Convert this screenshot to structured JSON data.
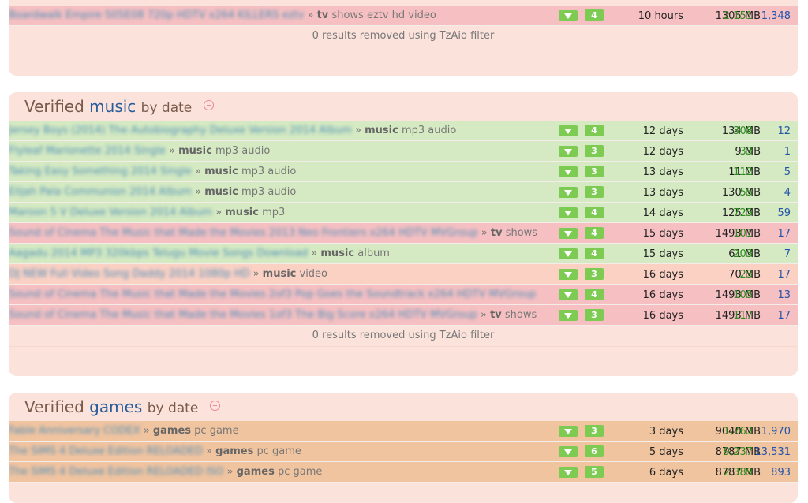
{
  "tv": {
    "rows": [
      {
        "title": "Boardwalk Empire S05E08 720p HDTV x264 KILLERS eztv",
        "cat": "tv",
        "sub": "shows eztv hd video",
        "score": "4",
        "age": "10 hours",
        "size": "1305 MB",
        "seeds": "2,151",
        "leeches": "1,348",
        "color": "pink"
      }
    ],
    "filter_text": "0 results removed using TzAio filter"
  },
  "music": {
    "heading": {
      "prefix": "Verified",
      "category": "music",
      "suffix": "by date"
    },
    "rows": [
      {
        "title": "Jersey Boys (2014) The Autobiography Deluxe Version 2014 Album",
        "cat": "music",
        "sub": "mp3 audio",
        "score": "4",
        "age": "12 days",
        "size": "134 MB",
        "seeds": "308",
        "leeches": "12",
        "color": "green"
      },
      {
        "title": "Flyleaf Marionette 2014 Single",
        "cat": "music",
        "sub": "mp3 audio",
        "score": "3",
        "age": "12 days",
        "size": "9 MB",
        "seeds": "33",
        "leeches": "1",
        "color": "green"
      },
      {
        "title": "Taking Easy Something 2014 Single",
        "cat": "music",
        "sub": "mp3 audio",
        "score": "3",
        "age": "13 days",
        "size": "11 MB",
        "seeds": "112",
        "leeches": "5",
        "color": "green"
      },
      {
        "title": "Elijah Pala Communion 2014 Album",
        "cat": "music",
        "sub": "mp3 audio",
        "score": "3",
        "age": "13 days",
        "size": "130 MB",
        "seeds": "55",
        "leeches": "4",
        "color": "green"
      },
      {
        "title": "Maroon 5 V Deluxe Version 2014 Album",
        "cat": "music",
        "sub": "mp3",
        "score": "4",
        "age": "14 days",
        "size": "125 MB",
        "seeds": "725",
        "leeches": "59",
        "color": "green"
      },
      {
        "title": "Sound of Cinema The Music that Made the Movies 2013 Neo Frontiers x264 HDTV MVGroup",
        "cat": "tv",
        "sub": "shows",
        "score": "4",
        "age": "15 days",
        "size": "1493 MB",
        "seeds": "101",
        "leeches": "17",
        "color": "pink"
      },
      {
        "title": "Aagadu 2014 MP3 320kbps Telugu Movie Songs Download",
        "cat": "music",
        "sub": "album",
        "score": "4",
        "age": "15 days",
        "size": "61 MB",
        "seeds": "203",
        "leeches": "7",
        "color": "green"
      },
      {
        "title": "DJ NEW Full Video Song Daddy 2014 1080p HD",
        "cat": "music",
        "sub": "video",
        "score": "3",
        "age": "16 days",
        "size": "70 MB",
        "seeds": "23",
        "leeches": "17",
        "color": "salmon"
      },
      {
        "title": "Sound of Cinema The Music that Made the Movies 2of3 Pop Goes the Soundtrack x264 HDTV MVGroup",
        "cat": "",
        "sub": "",
        "score": "4",
        "age": "16 days",
        "size": "1493 MB",
        "seeds": "105",
        "leeches": "13",
        "color": "pink"
      },
      {
        "title": "Sound of Cinema The Music that Made the Movies 1of3 The Big Score x264 HDTV MVGroup",
        "cat": "tv",
        "sub": "shows",
        "score": "3",
        "age": "16 days",
        "size": "1493 MB",
        "seeds": "117",
        "leeches": "17",
        "color": "pink"
      }
    ],
    "filter_text": "0 results removed using TzAio filter"
  },
  "games": {
    "heading": {
      "prefix": "Verified",
      "category": "games",
      "suffix": "by date"
    },
    "rows": [
      {
        "title": "Fable Anniversary CODEX",
        "cat": "games",
        "sub": "pc game",
        "score": "3",
        "age": "3 days",
        "size": "9040 MB",
        "seeds": "1,763",
        "leeches": "1,970",
        "color": "orange"
      },
      {
        "title": "The SIMS 4 Deluxe Edition RELOADED",
        "cat": "games",
        "sub": "pc game",
        "score": "6",
        "age": "5 days",
        "size": "8787 MB",
        "seeds": "9,237",
        "leeches": "13,531",
        "color": "orange"
      },
      {
        "title": "The SIMS 4 Deluxe Edition RELOADED ISO",
        "cat": "games",
        "sub": "pc game",
        "score": "5",
        "age": "6 days",
        "size": "8787 MB",
        "seeds": "2,389",
        "leeches": "893",
        "color": "orange"
      }
    ]
  },
  "colors": {
    "green_row": "#d5eac2",
    "pink_row": "#f6c0c2",
    "salmon_row": "#fbd1c4",
    "orange_row": "#f1c4a0",
    "panel": "#fbe3dc",
    "badge": "#7ecb53",
    "seeds": "#2e8b1e",
    "leeches": "#2255aa"
  }
}
